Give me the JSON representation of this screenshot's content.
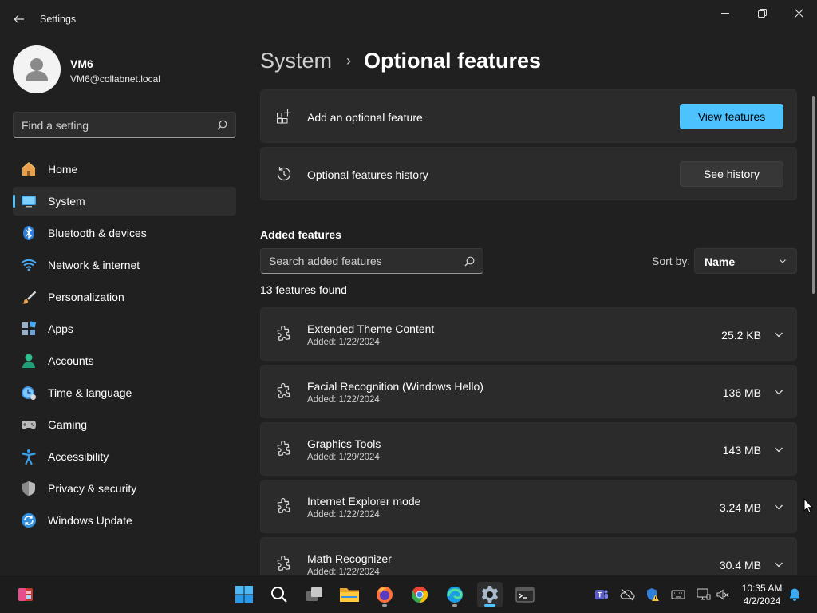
{
  "window": {
    "title": "Settings"
  },
  "profile": {
    "name": "VM6",
    "email": "VM6@collabnet.local"
  },
  "sidebar": {
    "search_placeholder": "Find a setting",
    "items": [
      {
        "label": "Home",
        "icon": "home-icon"
      },
      {
        "label": "System",
        "icon": "system-icon",
        "active": true
      },
      {
        "label": "Bluetooth & devices",
        "icon": "bluetooth-icon"
      },
      {
        "label": "Network & internet",
        "icon": "wifi-icon"
      },
      {
        "label": "Personalization",
        "icon": "brush-icon"
      },
      {
        "label": "Apps",
        "icon": "apps-icon"
      },
      {
        "label": "Accounts",
        "icon": "accounts-icon"
      },
      {
        "label": "Time & language",
        "icon": "time-language-icon"
      },
      {
        "label": "Gaming",
        "icon": "gamepad-icon"
      },
      {
        "label": "Accessibility",
        "icon": "accessibility-icon"
      },
      {
        "label": "Privacy & security",
        "icon": "shield-icon"
      },
      {
        "label": "Windows Update",
        "icon": "windows-update-icon"
      }
    ]
  },
  "breadcrumb": {
    "parent": "System",
    "separator": "›",
    "current": "Optional features"
  },
  "add_feature": {
    "label": "Add an optional feature",
    "button": "View features"
  },
  "history": {
    "label": "Optional features history",
    "button": "See history"
  },
  "added": {
    "section_title": "Added features",
    "search_placeholder": "Search added features",
    "sort_label": "Sort by:",
    "sort_value": "Name",
    "count_text": "13 features found",
    "features": [
      {
        "name": "Extended Theme Content",
        "date": "Added: 1/22/2024",
        "size": "25.2 KB"
      },
      {
        "name": "Facial Recognition (Windows Hello)",
        "date": "Added: 1/22/2024",
        "size": "136 MB"
      },
      {
        "name": "Graphics Tools",
        "date": "Added: 1/29/2024",
        "size": "143 MB"
      },
      {
        "name": "Internet Explorer mode",
        "date": "Added: 1/22/2024",
        "size": "3.24 MB"
      },
      {
        "name": "Math Recognizer",
        "date": "Added: 1/22/2024",
        "size": "30.4 MB"
      }
    ]
  },
  "taskbar": {
    "time": "10:35 AM",
    "date": "4/2/2024"
  },
  "colors": {
    "accent": "#4cc2ff",
    "background": "#202020",
    "card": "#2b2b2b"
  }
}
